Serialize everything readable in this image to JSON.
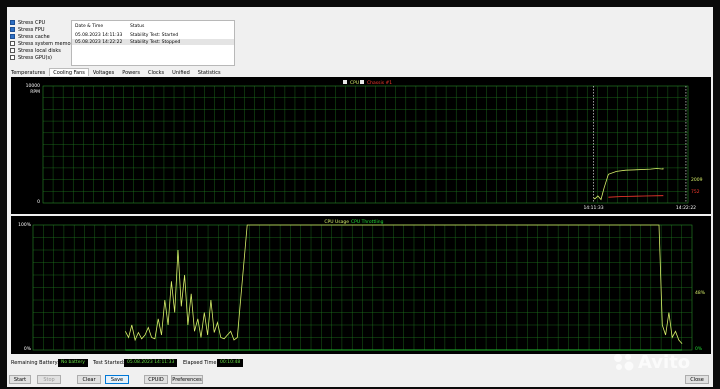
{
  "stress_options": [
    {
      "label": "Stress CPU",
      "checked": true
    },
    {
      "label": "Stress FPU",
      "checked": true
    },
    {
      "label": "Stress cache",
      "checked": true
    },
    {
      "label": "Stress system memory",
      "checked": false
    },
    {
      "label": "Stress local disks",
      "checked": false
    },
    {
      "label": "Stress GPU(s)",
      "checked": false
    }
  ],
  "log": {
    "headers": {
      "datetime": "Date & Time",
      "status": "Status"
    },
    "rows": [
      {
        "datetime": "05.08.2023 14:11:33",
        "status": "Stability Test: Started"
      },
      {
        "datetime": "05.08.2023 14:22:22",
        "status": "Stability Test: Stopped"
      }
    ]
  },
  "tabs": [
    "Temperatures",
    "Cooling Fans",
    "Voltages",
    "Powers",
    "Clocks",
    "Unified",
    "Statistics"
  ],
  "active_tab": "Cooling Fans",
  "colors": {
    "cpu_fan": "#d8f06a",
    "chassis_fan": "#ff3b2f",
    "cpu_usage": "#d8f06a",
    "throttling": "#22dd33",
    "grid": "#1f7a1f",
    "value_text": "#66dd44"
  },
  "chart_data": [
    {
      "type": "line",
      "legend": [
        "CPU",
        "Chassis #1"
      ],
      "ylabel": "RPM",
      "ytick_labels": [
        "10000",
        "0"
      ],
      "ylim": [
        0,
        10000
      ],
      "x_tick_labels": [
        "14:11:33",
        "14:22:22"
      ],
      "series": [
        {
          "name": "CPU",
          "x": [
            0.888,
            0.89,
            0.895,
            0.9,
            0.905,
            0.912,
            0.925,
            0.94,
            0.96,
            0.98,
            0.99,
            1.0,
            1.03
          ],
          "values": [
            450,
            350,
            600,
            300,
            1300,
            2450,
            2700,
            2800,
            2850,
            2900,
            2950,
            2900,
            3000
          ],
          "end_label": "2009"
        },
        {
          "name": "Chassis #1",
          "x": [
            0.912,
            0.94,
            0.97,
            1.0,
            1.03
          ],
          "values": [
            500,
            560,
            600,
            620,
            650
          ],
          "end_label": "752"
        }
      ]
    },
    {
      "type": "line",
      "legend": [
        "CPU Usage",
        "CPU Throttling"
      ],
      "ytick_labels": [
        "100%",
        "0%"
      ],
      "ylim": [
        0,
        100
      ],
      "series": [
        {
          "name": "CPU Usage",
          "end_label": "48%",
          "x": [
            0.14,
            0.145,
            0.15,
            0.155,
            0.16,
            0.165,
            0.17,
            0.175,
            0.18,
            0.185,
            0.19,
            0.195,
            0.2,
            0.205,
            0.21,
            0.215,
            0.22,
            0.225,
            0.23,
            0.235,
            0.24,
            0.245,
            0.25,
            0.255,
            0.26,
            0.265,
            0.27,
            0.275,
            0.28,
            0.285,
            0.29,
            0.295,
            0.3,
            0.305,
            0.31,
            0.325,
            0.95,
            0.955,
            0.96,
            0.965,
            0.97,
            0.975,
            0.98,
            0.985
          ],
          "values": [
            15,
            10,
            20,
            8,
            14,
            9,
            12,
            18,
            10,
            9,
            25,
            12,
            40,
            20,
            55,
            30,
            80,
            35,
            60,
            20,
            45,
            15,
            25,
            10,
            30,
            12,
            40,
            14,
            22,
            10,
            9,
            12,
            15,
            8,
            10,
            100,
            100,
            20,
            12,
            30,
            10,
            15,
            8,
            5
          ]
        },
        {
          "name": "CPU Throttling",
          "end_label": "0%",
          "x": [
            0.14,
            0.95,
            0.985
          ],
          "values": [
            0,
            0,
            0
          ]
        }
      ]
    }
  ],
  "status_bar": {
    "battery_label": "Remaining Battery:",
    "battery_value": "No battery",
    "started_label": "Test Started:",
    "started_value": "05.08.2023 14:11:33",
    "elapsed_label": "Elapsed Time:",
    "elapsed_value": "00:10:48"
  },
  "buttons": {
    "start": "Start",
    "stop": "Stop",
    "clear": "Clear",
    "save": "Save",
    "cpuid": "CPUID",
    "preferences": "Preferences",
    "close": "Close"
  },
  "watermark": "Avito"
}
